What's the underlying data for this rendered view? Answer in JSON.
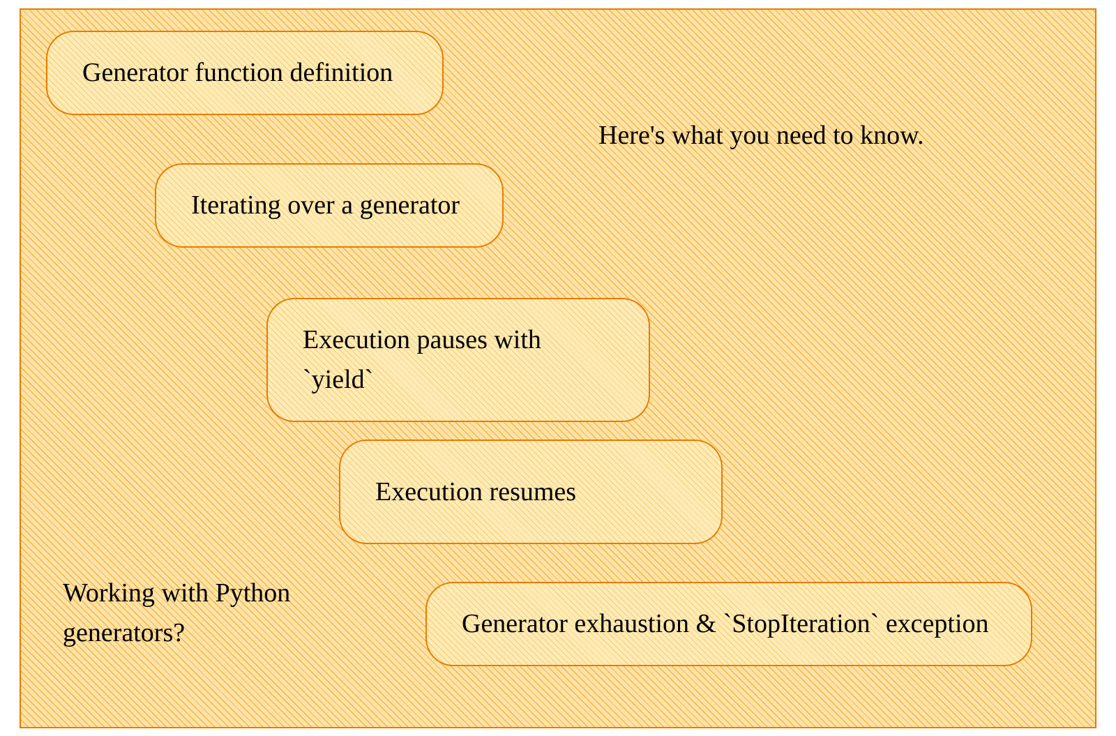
{
  "steps": [
    {
      "label": "Generator function definition"
    },
    {
      "label": "Iterating over a generator"
    },
    {
      "label": "Execution pauses with `yield`"
    },
    {
      "label": "Execution resumes"
    },
    {
      "label": "Generator exhaustion & `StopIteration` exception"
    }
  ],
  "annotations": {
    "top_right": "Here's what you need to know.",
    "bottom_left": "Working with Python generators?"
  }
}
